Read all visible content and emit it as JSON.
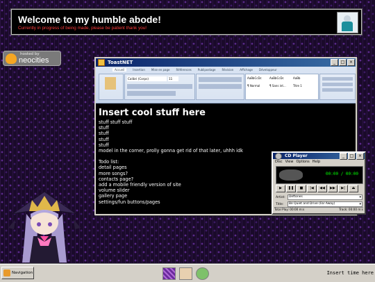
{
  "header": {
    "title": "Welcome to my humble abode!",
    "subtitle": "Currently in progress of being made, please be patient thank you!"
  },
  "neocities": {
    "hosted_by": "hosted by",
    "name": "neocities"
  },
  "window": {
    "title": "ToastNET",
    "ribbon_tabs": [
      "Accueil",
      "Insertion",
      "Mise en page",
      "Références",
      "Publipostage",
      "Révision",
      "Affichage",
      "Développeur"
    ],
    "font_name": "Calibri (Corps)",
    "font_size": "11",
    "styles": [
      "AaBbCcDc",
      "AaBbCcDc",
      "AaBb"
    ],
    "style_names": [
      "¶ Normal",
      "¶ Sans int...",
      "Titre 1"
    ],
    "heading": "Insert cool stuff here",
    "lines": [
      "stuff stuff stuff",
      "stuff",
      "stuff",
      "stuff",
      "stuff",
      "model in the corner, prolly gonna get rid of that later, uhhh idk",
      "",
      "Todo list:",
      "detail pages",
      "more songs?",
      "contacts page?",
      "add a mobile friendly version of site",
      "volume slider",
      "gallery page",
      "settings/fun buttons/pages"
    ]
  },
  "cd_player": {
    "title": "CD Player",
    "menu": [
      "Disc",
      "View",
      "Options",
      "Help"
    ],
    "time": "00:00 / 00:00",
    "artist_label": "Artist:",
    "artist": "Deftones",
    "title_label": "Title:",
    "track": "Be Quiet and Drive (Far Away)",
    "total_play": "Total Play: 00:00 m:s",
    "track_time": "Track: 00:00 m:s"
  },
  "taskbar": {
    "start_label": "Navigation",
    "clock_text": "Insert time here"
  },
  "colors": {
    "titlebar": "#0a246a",
    "subtitle": "#ff3c3c",
    "background": "#1a0a2a"
  }
}
